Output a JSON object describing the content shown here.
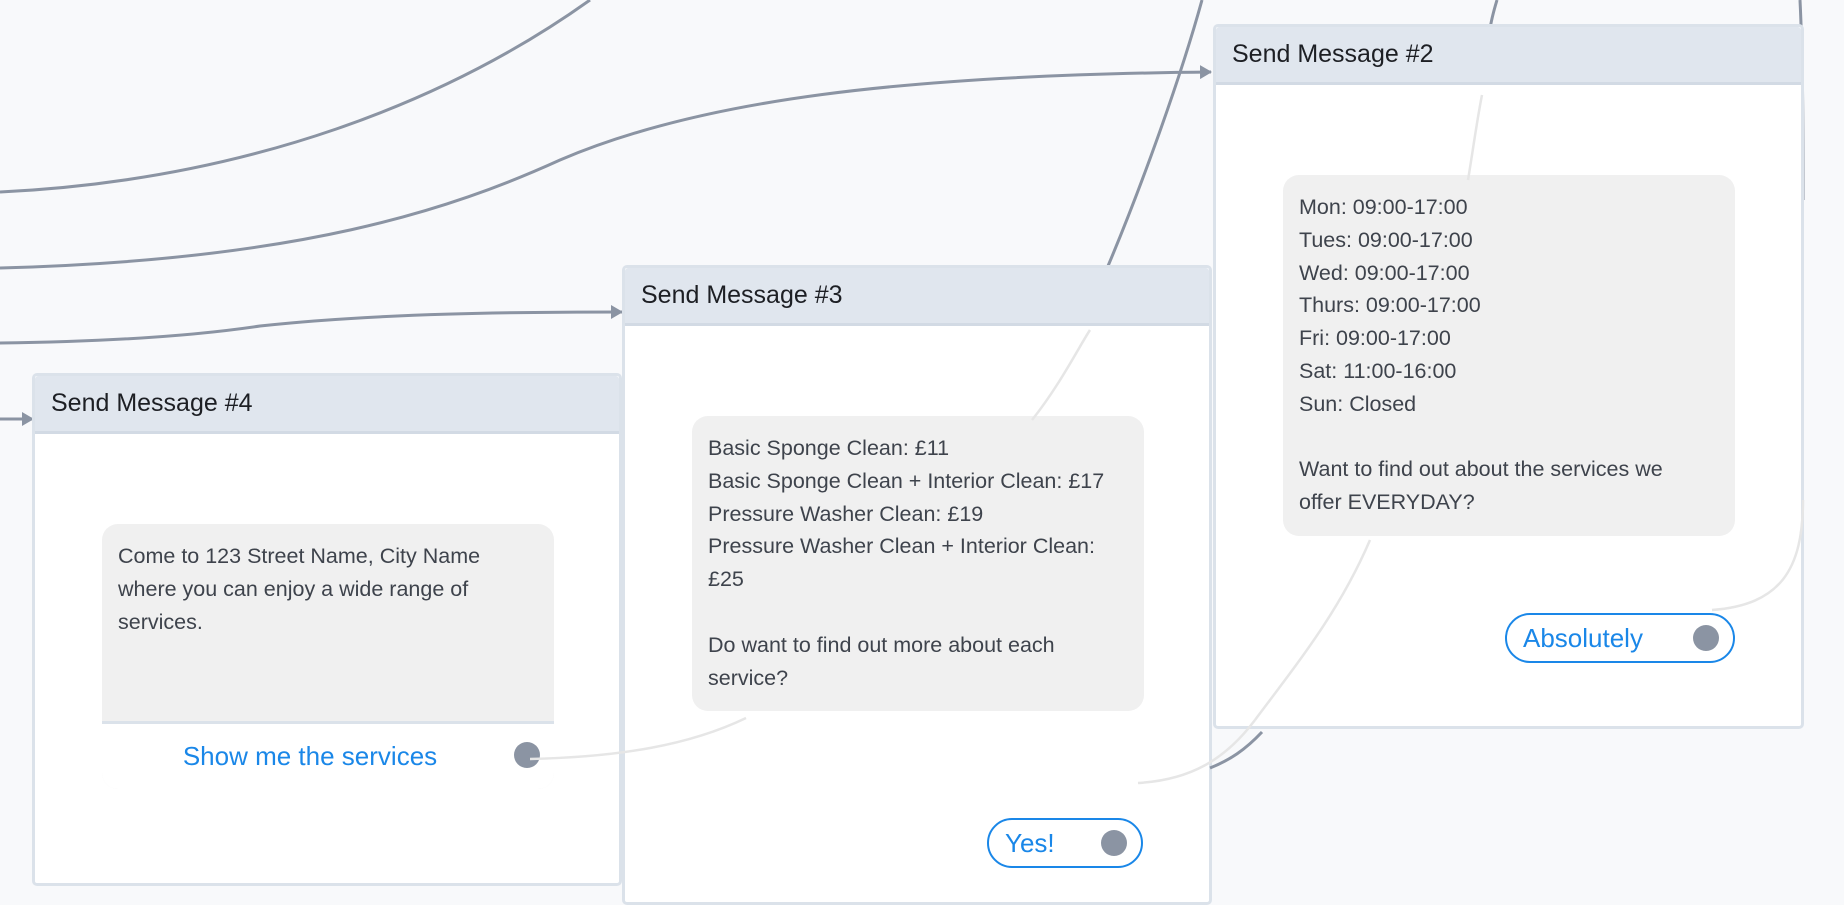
{
  "nodes": {
    "msg4": {
      "title": "Send Message #4",
      "lines": [
        "Come to 123 Street Name, City Name",
        "where you can enjoy a wide range of",
        "services."
      ],
      "button_label": "Show me the services"
    },
    "msg3": {
      "title": "Send Message #3",
      "lines": [
        "Basic Sponge Clean: £11",
        "Basic Sponge Clean + Interior Clean: £17",
        "Pressure Washer Clean: £19",
        "Pressure Washer Clean + Interior Clean:",
        "£25",
        "",
        "Do want to find out more about each",
        "service?"
      ],
      "button_label": "Yes!"
    },
    "msg2": {
      "title": "Send Message #2",
      "lines": [
        "Mon: 09:00-17:00",
        "Tues: 09:00-17:00",
        "Wed: 09:00-17:00",
        "Thurs: 09:00-17:00",
        "Fri: 09:00-17:00",
        "Sat: 11:00-16:00",
        "Sun: Closed",
        "",
        "Want to find out about the services we",
        "offer EVERYDAY?"
      ],
      "button_label": "Absolutely"
    }
  },
  "colors": {
    "canvas_bg": "#f8f9fb",
    "connector": "#8b94a3",
    "link_line": "#e6e6e6",
    "accent": "#1a87e8",
    "node_header": "#e0e6ee"
  }
}
